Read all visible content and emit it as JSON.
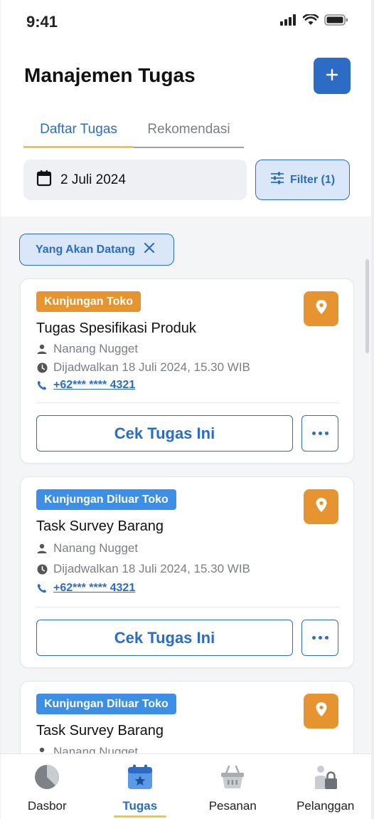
{
  "status_bar": {
    "time": "9:41"
  },
  "header": {
    "title": "Manajemen Tugas",
    "add_icon": "plus-icon"
  },
  "tabs": [
    {
      "label": "Daftar Tugas",
      "active": true
    },
    {
      "label": "Rekomendasi",
      "active": false
    }
  ],
  "date_filter": {
    "value": "2 Juli 2024",
    "icon": "calendar-icon"
  },
  "filter_button": {
    "label": "Filter (1)",
    "icon": "sliders-icon"
  },
  "active_chip": {
    "label": "Yang Akan Datang",
    "icon": "close-icon"
  },
  "tasks": [
    {
      "badge": "Kunjungan Toko",
      "badge_color": "#e6942f",
      "title": "Tugas Spesifikasi Produk",
      "person": "Nanang Nugget",
      "schedule": "Dijadwalkan 18 Juli 2024, 15.30 WIB",
      "phone": "+62*** **** 4321",
      "action_label": "Cek Tugas Ini"
    },
    {
      "badge": "Kunjungan Diluar Toko",
      "badge_color": "#3d8fe6",
      "title": "Task Survey Barang",
      "person": "Nanang Nugget",
      "schedule": "Dijadwalkan 18 Juli 2024, 15.30 WIB",
      "phone": "+62*** **** 4321",
      "action_label": "Cek Tugas Ini"
    },
    {
      "badge": "Kunjungan Diluar Toko",
      "badge_color": "#3d8fe6",
      "title": "Task Survey Barang",
      "person": "Nanang Nugget"
    }
  ],
  "bottom_nav": [
    {
      "label": "Dasbor",
      "icon": "pie-chart-icon",
      "active": false
    },
    {
      "label": "Tugas",
      "icon": "calendar-star-icon",
      "active": true
    },
    {
      "label": "Pesanan",
      "icon": "basket-icon",
      "active": false
    },
    {
      "label": "Pelanggan",
      "icon": "customer-lock-icon",
      "active": false
    }
  ],
  "colors": {
    "primary": "#2c6cc4",
    "accent": "#f2c444",
    "orange": "#e6942f",
    "blue_badge": "#3d8fe6"
  }
}
